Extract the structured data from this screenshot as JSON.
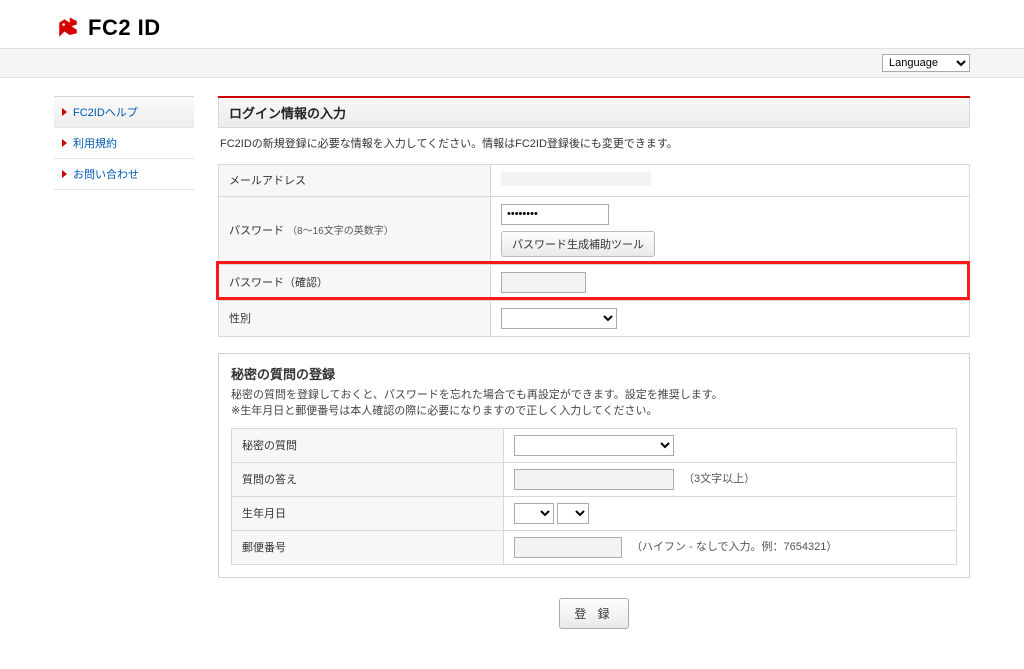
{
  "brand": {
    "name": "FC2 ID"
  },
  "language": {
    "selected": "Language"
  },
  "sidebar": {
    "items": [
      {
        "label": "FC2IDヘルプ"
      },
      {
        "label": "利用規約"
      },
      {
        "label": "お問い合わせ"
      }
    ]
  },
  "login_section": {
    "header": "ログイン情報の入力",
    "desc": "FC2IDの新規登録に必要な情報を入力してください。情報はFC2ID登録後にも変更できます。",
    "rows": {
      "email_label": "メールアドレス",
      "password_label": "パスワード ",
      "password_note": "（8〜16文字の英数字）",
      "password_tool_btn": "パスワード生成補助ツール",
      "password_confirm_label": "パスワード（確認）",
      "gender_label": "性別"
    }
  },
  "secret_section": {
    "title": "秘密の質問の登録",
    "desc1": "秘密の質問を登録しておくと、パスワードを忘れた場合でも再設定ができます。設定を推奨します。",
    "desc2": "※生年月日と郵便番号は本人確認の際に必要になりますので正しく入力してください。",
    "rows": {
      "question_label": "秘密の質問",
      "answer_label": "質問の答え",
      "answer_hint": "（3文字以上）",
      "birth_label": "生年月日",
      "postal_label": "郵便番号",
      "postal_hint": "（ハイフン - なしで入力。例：7654321）"
    }
  },
  "register_btn": "登 録"
}
